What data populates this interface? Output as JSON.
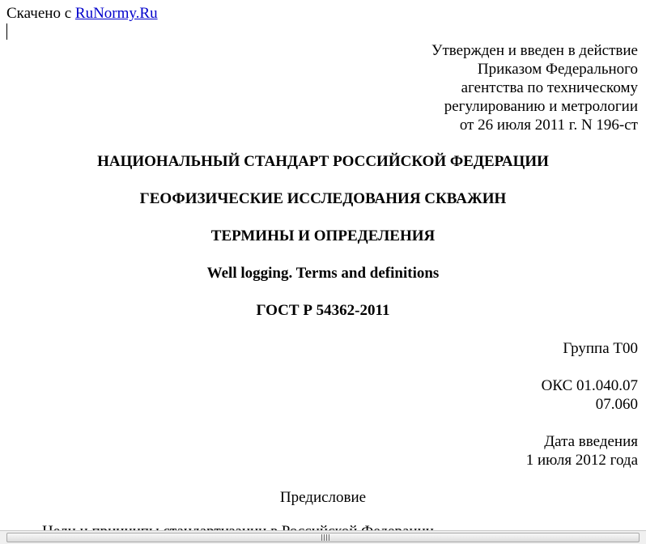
{
  "source": {
    "prefix": "Скачено с ",
    "link_text": "RuNormy.Ru"
  },
  "approval": {
    "lines": [
      "Утвержден и введен в действие",
      "Приказом Федерального",
      "агентства по техническому",
      "регулированию и метрологии",
      "от 26 июля 2011 г. N 196-ст"
    ]
  },
  "header": {
    "standard_type": "НАЦИОНАЛЬНЫЙ СТАНДАРТ РОССИЙСКОЙ ФЕДЕРАЦИИ",
    "title": "ГЕОФИЗИЧЕСКИЕ ИССЛЕДОВАНИЯ СКВАЖИН",
    "subtitle": "ТЕРМИНЫ И ОПРЕДЕЛЕНИЯ",
    "english_title": "Well logging. Terms and definitions",
    "designation": "ГОСТ Р 54362-2011"
  },
  "classification": {
    "group": "Группа Т00",
    "oks_line1": "ОКС 01.040.07",
    "oks_line2": "07.060"
  },
  "effective": {
    "label": "Дата введения",
    "date": "1 июля 2012 года"
  },
  "foreword": {
    "heading": "Предисловие",
    "cutoff_text": "Цели и принципы стандартизации в Российской Федерации"
  }
}
